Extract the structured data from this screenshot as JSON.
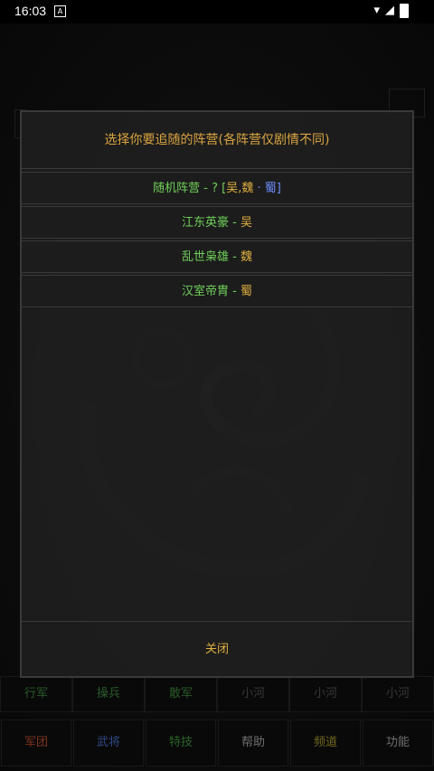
{
  "status_bar": {
    "time": "16:03",
    "notification_icon": "A"
  },
  "dialog": {
    "title": "选择你要追随的阵营(各阵营仅剧情不同)",
    "options": [
      {
        "prefix": "随机阵营 - ? [",
        "part_a": "吴",
        "sep": ",",
        "part_b": "魏",
        "dot": "·",
        "part_c": "蜀",
        "suffix": "]"
      },
      {
        "name": "江东英豪",
        "sep": " - ",
        "faction": "吴"
      },
      {
        "name": "乱世枭雄",
        "sep": " - ",
        "faction": "魏"
      },
      {
        "name": "汉室帝胄",
        "sep": " - ",
        "faction": "蜀"
      }
    ],
    "close_label": "关闭"
  },
  "bottom_row1": [
    "行军",
    "操兵",
    "散军",
    "小河",
    "小河",
    "小河"
  ],
  "bottom_nav": [
    "军团",
    "武将",
    "特技",
    "帮助",
    "频道",
    "功能"
  ],
  "colors": {
    "title_gold": "#d9a441",
    "green": "#6fcf5a",
    "blue": "#6f8fff",
    "gold": "#e0b040",
    "panel_bg": "#1e1e1e"
  }
}
